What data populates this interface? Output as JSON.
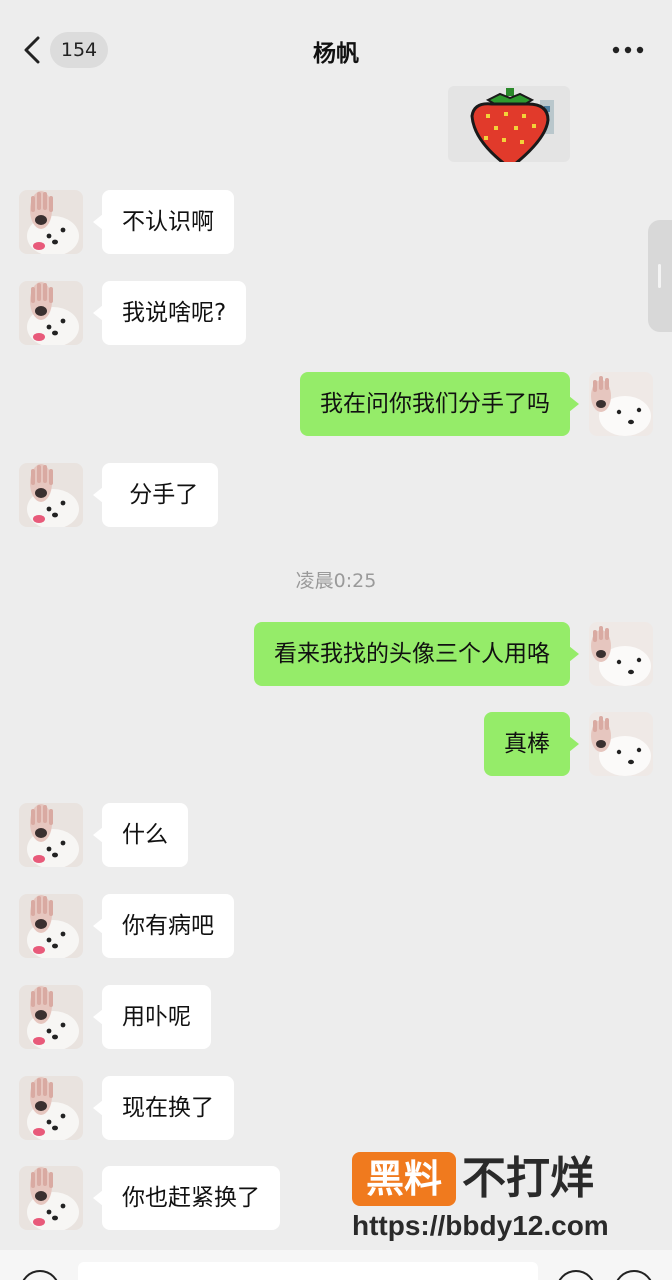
{
  "header": {
    "unread_count": "154",
    "title": "杨帆"
  },
  "timestamp": "凌晨0:25",
  "messages": [
    {
      "side": "in",
      "text": "不认识啊"
    },
    {
      "side": "in",
      "text": "我说啥呢?"
    },
    {
      "side": "out",
      "text": "我在问你我们分手了吗"
    },
    {
      "side": "in",
      "text": " 分手了"
    },
    {
      "side": "out",
      "text": "看来我找的头像三个人用咯"
    },
    {
      "side": "out",
      "text": "真棒"
    },
    {
      "side": "in",
      "text": "什么"
    },
    {
      "side": "in",
      "text": "你有病吧"
    },
    {
      "side": "in",
      "text": "用卟呢"
    },
    {
      "side": "in",
      "text": "现在换了"
    },
    {
      "side": "in",
      "text": "你也赶紧换了"
    }
  ],
  "watermark": {
    "box_text": "黑料",
    "text": "不打烊",
    "url": "https://bbdy12.com"
  },
  "colors": {
    "background": "#ededed",
    "incoming_bubble": "#ffffff",
    "outgoing_bubble": "#95ec69",
    "watermark_accent": "#f07a1e"
  },
  "icons": {
    "back": "chevron-left-icon",
    "more": "more-dots-icon",
    "sticker": "strawberry-sticker"
  }
}
